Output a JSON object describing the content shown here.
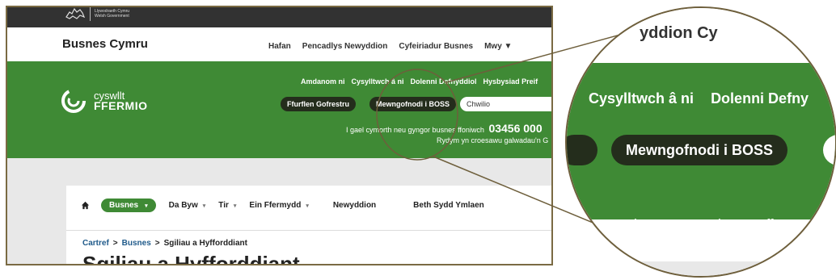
{
  "gov": {
    "line1": "Llywodraeth Cymru",
    "line2": "Welsh Government"
  },
  "site": {
    "title": "Busnes Cymru"
  },
  "topnav": {
    "items": [
      "Hafan",
      "Pencadlys Newyddion",
      "Cyfeiriadur Busnes"
    ],
    "more": "Mwy ▼"
  },
  "brand": {
    "line1": "cyswllt",
    "line2": "FFERMIO"
  },
  "utility": {
    "items": [
      "Amdanom ni",
      "Cysylltwch â ni",
      "Dolenni Defnyddiol",
      "Hysbysiad Preif"
    ]
  },
  "buttons": {
    "register": "Ffurflen Gofrestru",
    "login": "Mewngofnodi i BOSS"
  },
  "search": {
    "placeholder": "Chwilio"
  },
  "contact": {
    "text": "I gael cymorth neu gyngor busnes ffoniwch",
    "phone": "03456 000",
    "welcome": "Rydym yn croesawu galwadau'n G"
  },
  "mainnav": {
    "home_icon": "home-icon",
    "active": "Busnes",
    "items": [
      "Da Byw",
      "Tir",
      "Ein Ffermydd",
      "Newyddion",
      "Beth Sydd Ymlaen"
    ]
  },
  "breadcrumb": {
    "home": "Cartref",
    "section": "Busnes",
    "current": "Sgiliau a Hyfforddiant",
    "separator": ">"
  },
  "page": {
    "title": "Sgiliau a Hyfforddiant"
  },
  "zoom": {
    "topnav": "yddion   Cy",
    "utility": [
      "Cysylltwch â ni",
      "Dolenni Defny"
    ],
    "login": "Mewngofnodi i BOSS",
    "phone_text": "cymorth neu gyngor busnes ffo",
    "welcome_text": "Rydym y"
  },
  "colors": {
    "brand_green": "#3f8a35",
    "dark_button": "#242d1c",
    "frame_border": "#7a6a43",
    "gov_bar": "#323232"
  }
}
